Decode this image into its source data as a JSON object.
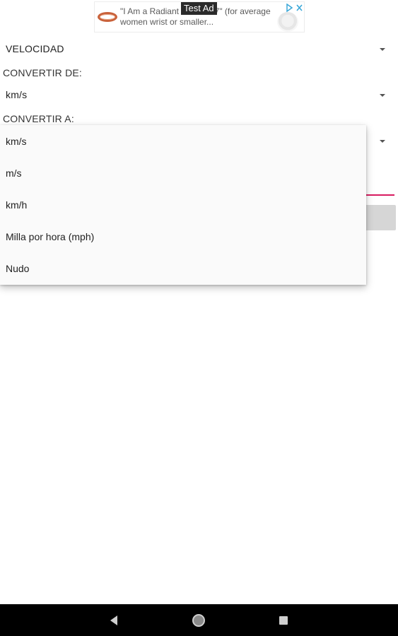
{
  "ad": {
    "badge": "Test Ad",
    "text": "\"I Am a Radiant Bracelet 7\" (for average women wrist or smaller...",
    "choices_icon": "ad-choices-icon"
  },
  "category_spinner": {
    "value": "VELOCIDAD"
  },
  "from": {
    "label": "CONVERTIR DE:",
    "value": "km/s"
  },
  "to": {
    "label": "CONVERTIR A:"
  },
  "dropdown": {
    "items": [
      "km/s",
      "m/s",
      "km/h",
      "Milla por hora (mph)",
      "Nudo"
    ]
  },
  "navbar": {
    "icons": [
      "back-icon",
      "home-icon",
      "recent-apps-icon"
    ]
  },
  "colors": {
    "accent": "#d81b60",
    "navbar": "#000000",
    "dropdown_bg": "#fafafa"
  }
}
